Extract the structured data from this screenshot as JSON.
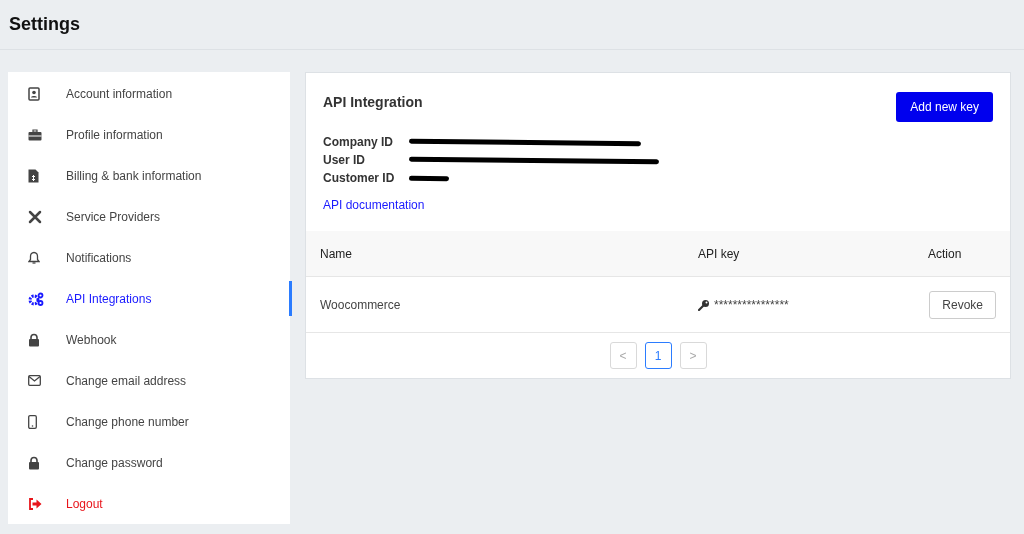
{
  "header": {
    "title": "Settings"
  },
  "sidebar": {
    "items": [
      {
        "label": "Account information",
        "selected": false,
        "kind": "normal"
      },
      {
        "label": "Profile information",
        "selected": false,
        "kind": "normal"
      },
      {
        "label": "Billing & bank information",
        "selected": false,
        "kind": "normal"
      },
      {
        "label": "Service Providers",
        "selected": false,
        "kind": "normal"
      },
      {
        "label": "Notifications",
        "selected": false,
        "kind": "normal"
      },
      {
        "label": "API Integrations",
        "selected": true,
        "kind": "normal"
      },
      {
        "label": "Webhook",
        "selected": false,
        "kind": "normal"
      },
      {
        "label": "Change email address",
        "selected": false,
        "kind": "normal"
      },
      {
        "label": "Change phone number",
        "selected": false,
        "kind": "normal"
      },
      {
        "label": "Change password",
        "selected": false,
        "kind": "normal"
      },
      {
        "label": "Logout",
        "selected": false,
        "kind": "danger"
      }
    ]
  },
  "panel": {
    "title": "API Integration",
    "add_button": "Add new key",
    "fields": [
      {
        "label": "Company ID",
        "redacted": true
      },
      {
        "label": "User ID",
        "redacted": true
      },
      {
        "label": "Customer ID",
        "redacted": true
      }
    ],
    "doc_link": "API documentation",
    "table": {
      "columns": [
        "Name",
        "API key",
        "Action"
      ],
      "rows": [
        {
          "name": "Woocommerce",
          "api_key": "****************",
          "action": "Revoke"
        }
      ]
    },
    "pagination": {
      "prev": "<",
      "next": ">",
      "pages": [
        {
          "label": "1",
          "selected": true
        }
      ]
    }
  }
}
